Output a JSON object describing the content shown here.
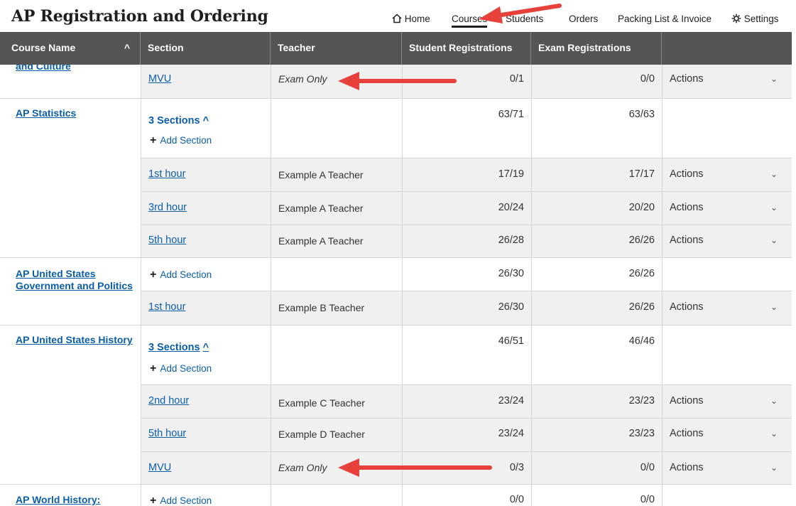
{
  "title": "AP Registration and Ordering",
  "nav": {
    "home": "Home",
    "courses": "Courses",
    "students": "Students",
    "orders": "Orders",
    "packing": "Packing List & Invoice",
    "settings": "Settings"
  },
  "columns": {
    "course_name": "Course Name",
    "section": "Section",
    "teacher": "Teacher",
    "student_reg": "Student Registrations",
    "exam_reg": "Exam Registrations"
  },
  "rows": {
    "r0": {
      "course": "and Culture",
      "section": "MVU",
      "teacher": "Exam Only",
      "student": "0/1",
      "exam": "0/0",
      "actions": "Actions"
    },
    "r1": {
      "course": "AP Statistics",
      "sections": "3 Sections",
      "add": "Add Section",
      "student": "63/71",
      "exam": "63/63"
    },
    "r2": {
      "section": "1st hour",
      "teacher": "Example A Teacher",
      "student": "17/19",
      "exam": "17/17",
      "actions": "Actions"
    },
    "r3": {
      "section": "3rd hour",
      "teacher": "Example A Teacher",
      "student": "20/24",
      "exam": "20/20",
      "actions": "Actions"
    },
    "r4": {
      "section": "5th hour",
      "teacher": "Example A Teacher",
      "student": "26/28",
      "exam": "26/26",
      "actions": "Actions"
    },
    "r5": {
      "course": "AP United States Government and Politics",
      "add": "Add Section",
      "student": "26/30",
      "exam": "26/26"
    },
    "r6": {
      "section": "1st hour",
      "teacher": "Example B Teacher",
      "student": "26/30",
      "exam": "26/26",
      "actions": "Actions"
    },
    "r7": {
      "course": "AP United States History",
      "sections": "3 Sections",
      "add": "Add Section",
      "student": "46/51",
      "exam": "46/46"
    },
    "r8": {
      "section": "2nd hour",
      "teacher": "Example C Teacher",
      "student": "23/24",
      "exam": "23/23",
      "actions": "Actions"
    },
    "r9": {
      "section": "5th hour",
      "teacher": "Example D Teacher",
      "student": "23/24",
      "exam": "23/23",
      "actions": "Actions"
    },
    "r10": {
      "section": "MVU",
      "teacher": "Exam Only",
      "student": "0/3",
      "exam": "0/0",
      "actions": "Actions"
    },
    "r11": {
      "course": "AP World History:",
      "add": "Add Section",
      "student": "0/0",
      "exam": "0/0"
    }
  },
  "colors": {
    "link": "#0b5ea8",
    "header_bg": "#555555",
    "arrow": "#e8403a",
    "alt_row": "#f0f0f0"
  }
}
